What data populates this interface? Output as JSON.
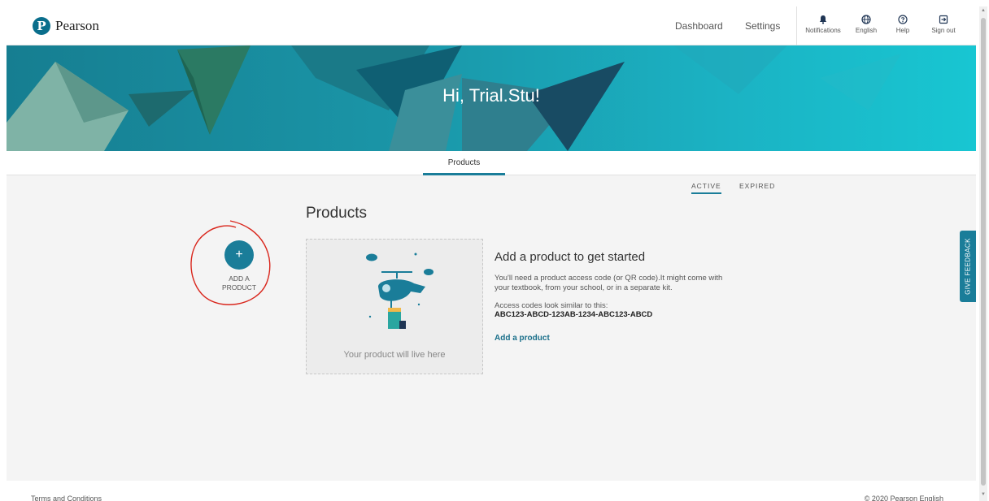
{
  "header": {
    "logo_text": "Pearson",
    "logo_letter": "P",
    "nav": {
      "dashboard": "Dashboard",
      "settings": "Settings"
    },
    "icons": [
      {
        "name": "bell-icon",
        "label": "Notifications"
      },
      {
        "name": "globe-icon",
        "label": "English"
      },
      {
        "name": "help-icon",
        "label": "Help"
      },
      {
        "name": "sign-out-icon",
        "label": "Sign out"
      }
    ]
  },
  "hero": {
    "greeting": "Hi, Trial.Stu!"
  },
  "tabs": {
    "products": "Products"
  },
  "filters": {
    "active": "ACTIVE",
    "expired": "EXPIRED"
  },
  "main": {
    "title": "Products",
    "add_product": {
      "icon": "+",
      "line1": "ADD A",
      "line2": "PRODUCT"
    },
    "placeholder_text": "Your product will live here",
    "info_title": "Add a product to get started",
    "info_text": "You'll need a product access code (or QR code).It might come with your textbook, from your school, or in a separate kit.",
    "code_label": "Access codes look similar to this:",
    "code_example": "ABC123-ABCD-123AB-1234-ABC123-ABCD",
    "add_link": "Add a product"
  },
  "feedback_label": "GIVE FEEDBACK",
  "footer": {
    "terms": "Terms and Conditions",
    "copyright": "© 2020 Pearson English"
  },
  "colors": {
    "accent": "#1a7d99",
    "hero_dark": "#167e91",
    "hero_light": "#18c6d2",
    "annotation": "#d9261c"
  }
}
